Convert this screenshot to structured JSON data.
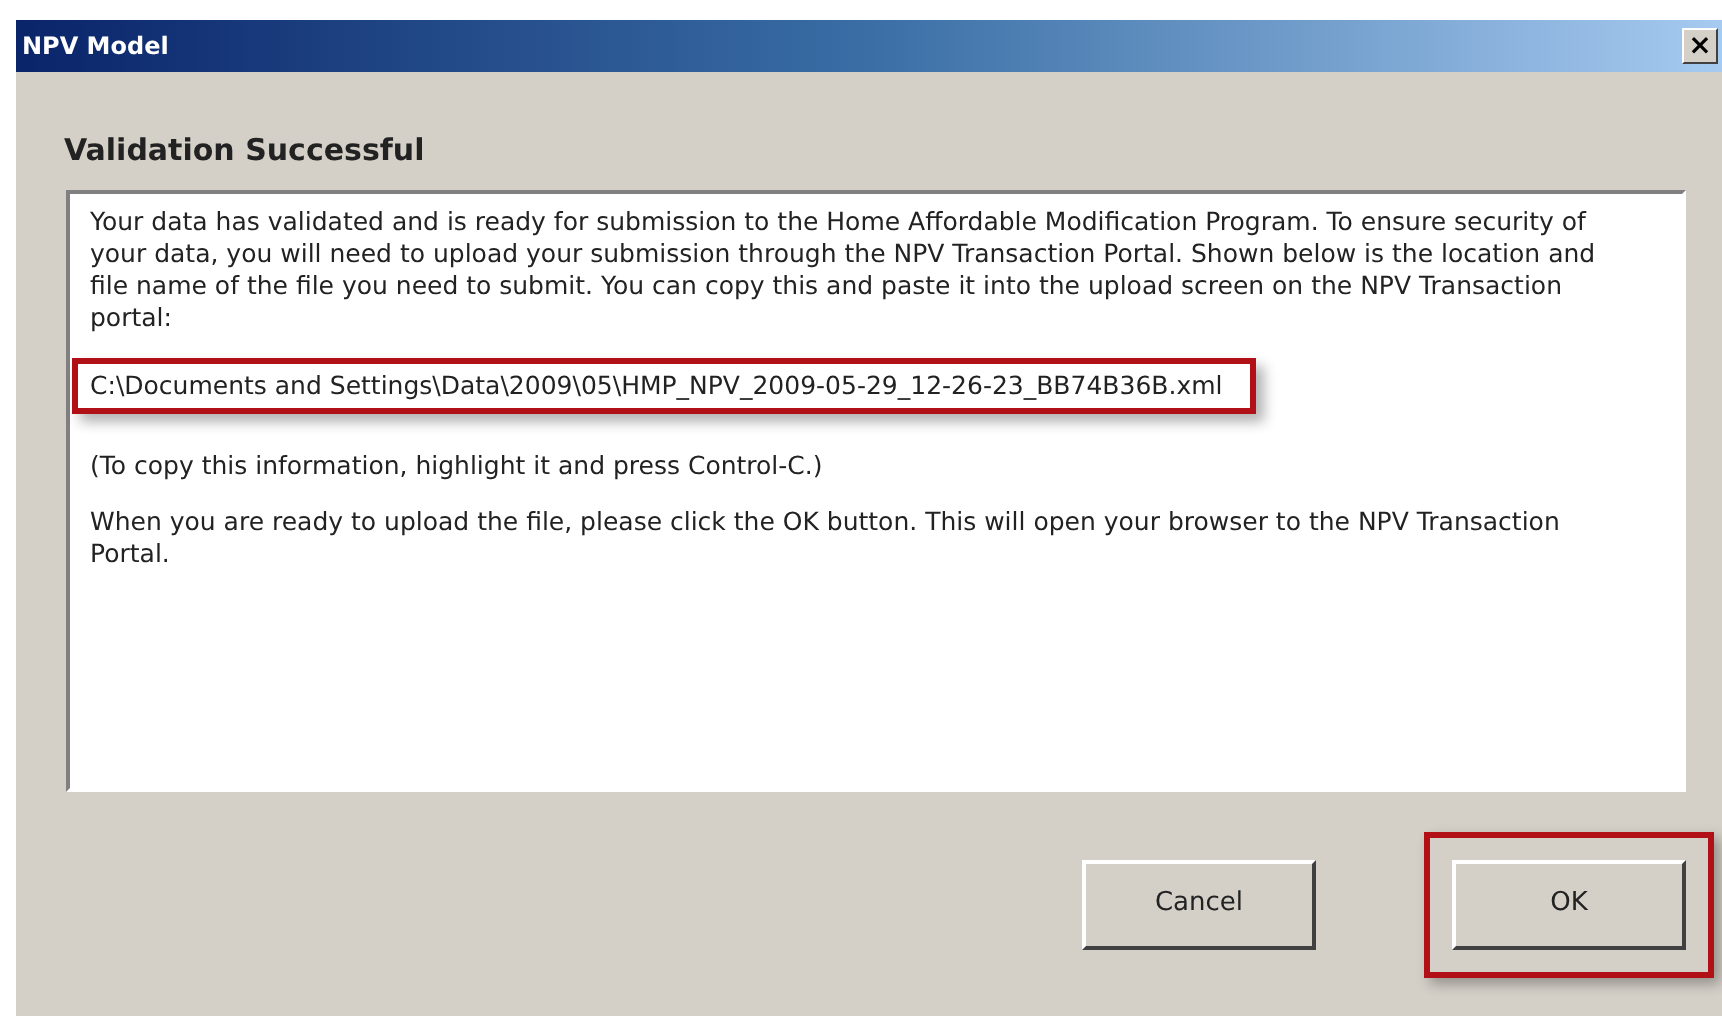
{
  "window": {
    "title": "NPV Model",
    "close_label": "×"
  },
  "heading": "Validation Successful",
  "message": [
    {
      "kind": "text",
      "text": "Your data has validated and is ready for submission to the Home Affordable Modification Program. To ensure security of your data, you will need to upload your submission through the NPV Transaction Portal. Shown below is the location and file name of the file you need to submit. You can copy this and paste it into the upload screen on the NPV Transaction portal:",
      "highlighted": false
    },
    {
      "kind": "path",
      "text": "C:\\Documents and Settings\\Data\\2009\\05\\HMP_NPV_2009-05-29_12-26-23_BB74B36B.xml",
      "highlighted": true
    },
    {
      "kind": "text",
      "text": "(To copy this information, highlight it and press Control-C.)",
      "highlighted": false
    },
    {
      "kind": "text",
      "text": "When you are ready to upload the file, please click the OK button. This will open your browser to the NPV Transaction Portal.",
      "highlighted": false
    }
  ],
  "buttons": [
    {
      "label": "Cancel",
      "highlighted": false
    },
    {
      "label": "OK",
      "highlighted": true
    }
  ]
}
